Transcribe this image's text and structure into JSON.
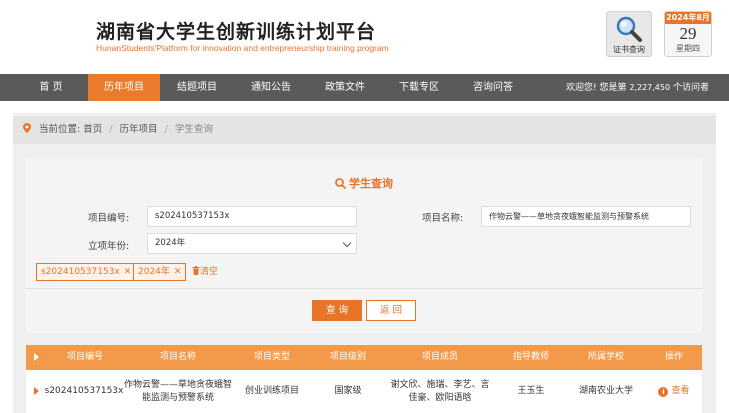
{
  "header": {
    "title": "湖南省大学生创新训练计划平台",
    "subtitle": "HunanStudents'Platform for innovation and entrepreneurship training program",
    "cert_label": "证书查询",
    "date": {
      "month": "2024年8月",
      "day": "29",
      "weekday": "星期四"
    }
  },
  "nav": {
    "items": [
      {
        "label": "首  页",
        "active": false
      },
      {
        "label": "历年项目",
        "active": true
      },
      {
        "label": "结题项目",
        "active": false
      },
      {
        "label": "通知公告",
        "active": false
      },
      {
        "label": "政策文件",
        "active": false
      },
      {
        "label": "下载专区",
        "active": false
      },
      {
        "label": "咨询问答",
        "active": false
      }
    ],
    "visitor_prefix": "欢迎您!  您是第",
    "visitor_count": "2,227,450",
    "visitor_suffix": "个访问者"
  },
  "breadcrumb": {
    "prefix": "当前位置:",
    "items": [
      "首页",
      "历年项目",
      "学生查询"
    ]
  },
  "search": {
    "title": "学生查询",
    "project_no_label": "项目编号:",
    "project_no_value": "s202410537153x",
    "project_name_label": "项目名称:",
    "project_name_value": "作物云警——草地贪夜蛾智能监测与预警系统",
    "year_label": "立项年份:",
    "year_value": "2024年",
    "tags": [
      "s202410537153x",
      "2024年"
    ],
    "clear_label": "清空",
    "query_button": "查 询",
    "back_button": "返 回"
  },
  "table": {
    "headers": [
      "项目编号",
      "项目名称",
      "项目类型",
      "项目级别",
      "项目成员",
      "指导教师",
      "所属学校",
      "操作"
    ],
    "rows": [
      {
        "project_no": "s202410537153x",
        "project_name": "作物云警——草地贪夜蛾智能监测与预警系统",
        "project_type": "创业训练项目",
        "level": "国家级",
        "members": "谢文欣、施瑞、李艺、言佳豪、欧阳语晗",
        "teacher": "王玉生",
        "school": "湖南农业大学",
        "action": "查看"
      }
    ]
  },
  "colors": {
    "accent": "#e8742a",
    "nav_bg": "#5a5a5a",
    "table_head": "#f29a4a"
  }
}
